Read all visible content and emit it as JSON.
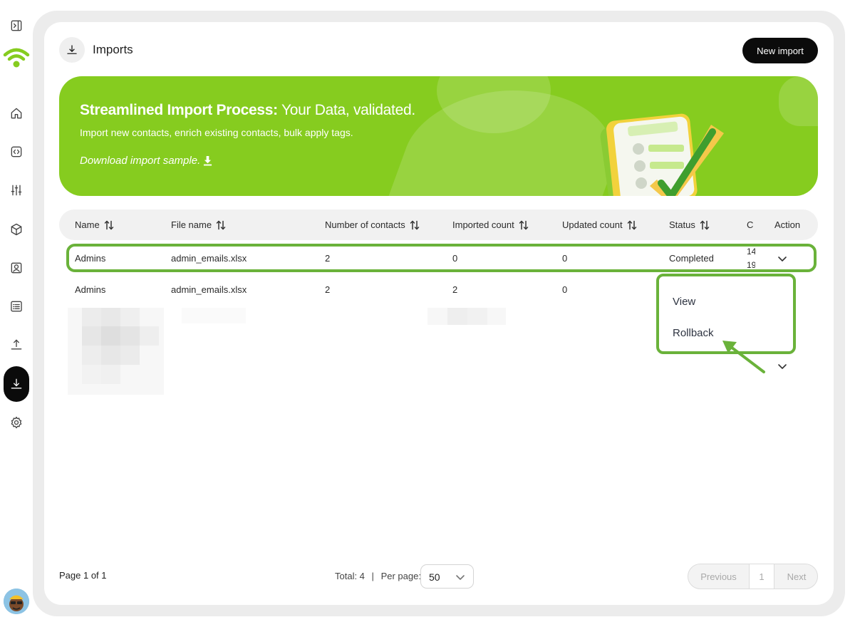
{
  "page": {
    "title": "Imports",
    "new_import_label": "New import"
  },
  "banner": {
    "title_bold": "Streamlined Import Process:",
    "title_rest": " Your Data, validated.",
    "subtitle": "Import new contacts, enrich existing contacts, bulk apply tags.",
    "link_label": "Download import sample."
  },
  "table": {
    "columns": [
      "Name",
      "File name",
      "Number of contacts",
      "Imported count",
      "Updated count",
      "Status",
      "C",
      "Action"
    ],
    "rows": [
      {
        "name": "Admins",
        "file": "admin_emails.xlsx",
        "contacts": "2",
        "imported": "0",
        "updated": "0",
        "status": "Completed",
        "created_top": "14",
        "created_bottom": "19"
      },
      {
        "name": "Admins",
        "file": "admin_emails.xlsx",
        "contacts": "2",
        "imported": "2",
        "updated": "0"
      }
    ]
  },
  "dropdown": {
    "items": [
      "View",
      "Rollback"
    ]
  },
  "footer": {
    "page_info": "Page 1 of 1",
    "total": "Total: 4",
    "separator": "|",
    "per_page_label": "Per page:",
    "per_page_value": "50",
    "prev_label": "Previous",
    "current_page": "1",
    "next_label": "Next"
  },
  "colors": {
    "accent_green": "#86cc1f",
    "highlight_green": "#6ab23a",
    "dark": "#0b0b0b"
  },
  "icons": {
    "sidebar": [
      "sidebar-toggle-icon",
      "wifi-logo-icon",
      "home-icon",
      "code-icon",
      "sliders-icon",
      "box-icon",
      "contact-icon",
      "list-icon",
      "upload-icon",
      "download-icon",
      "settings-icon"
    ]
  }
}
